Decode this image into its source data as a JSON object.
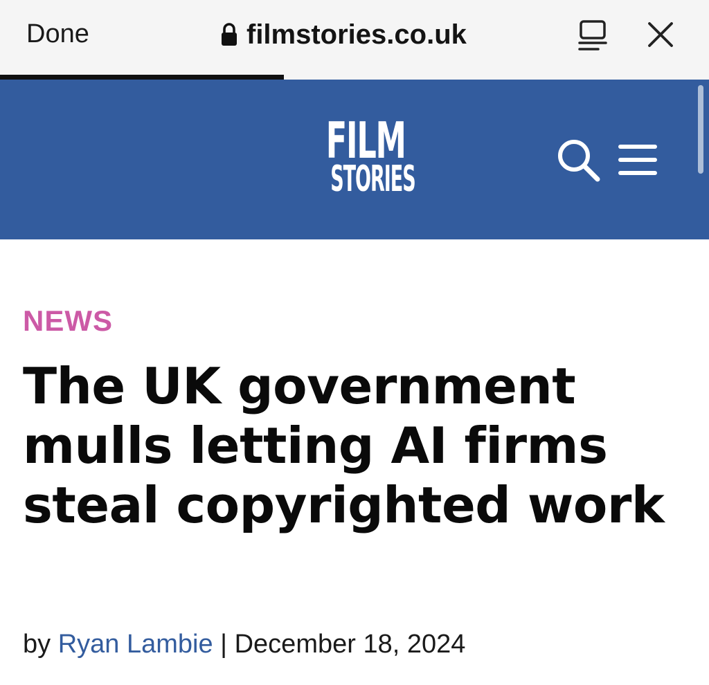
{
  "browser": {
    "done_label": "Done",
    "url": "filmstories.co.uk",
    "load_progress": 0.4
  },
  "site": {
    "logo_line1": "FILM",
    "logo_line2": "STORIES",
    "header_color": "#335c9e",
    "icons": [
      "search-icon",
      "menu-icon"
    ]
  },
  "article": {
    "category": "NEWS",
    "category_color": "#cc5aa6",
    "headline": "The UK government mulls letting AI firms steal copyrighted work",
    "byline_prefix": "by",
    "author": "Ryan Lambie",
    "separator": "|",
    "date": "December 18, 2024"
  }
}
